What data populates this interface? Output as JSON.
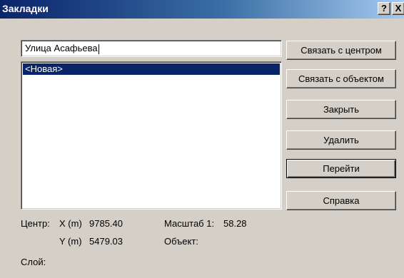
{
  "window": {
    "title": "Закладки",
    "help_glyph": "?",
    "close_glyph": "X"
  },
  "bookmark_name": {
    "value": "Улица Асафьева"
  },
  "bookmarks_list": {
    "items": [
      {
        "label": "<Новая>",
        "selected": true
      }
    ]
  },
  "buttons": {
    "link_center": "Связать с центром",
    "link_object": "Связать с объектом",
    "close": "Закрыть",
    "delete": "Удалить",
    "goto": "Перейти",
    "help": "Справка"
  },
  "info": {
    "center_label": "Центр:",
    "x_label": "X (m)",
    "x_value": "9785.40",
    "y_label": "Y (m)",
    "y_value": "5479.03",
    "scale_label": "Масштаб 1:",
    "scale_value": "58.28",
    "object_label": "Объект:",
    "layer_label": "Слой:"
  },
  "colors": {
    "titlebar_start": "#0a246a",
    "titlebar_end": "#a6caf0",
    "dialog_bg": "#d4d0c8",
    "selection": "#0a246a"
  }
}
